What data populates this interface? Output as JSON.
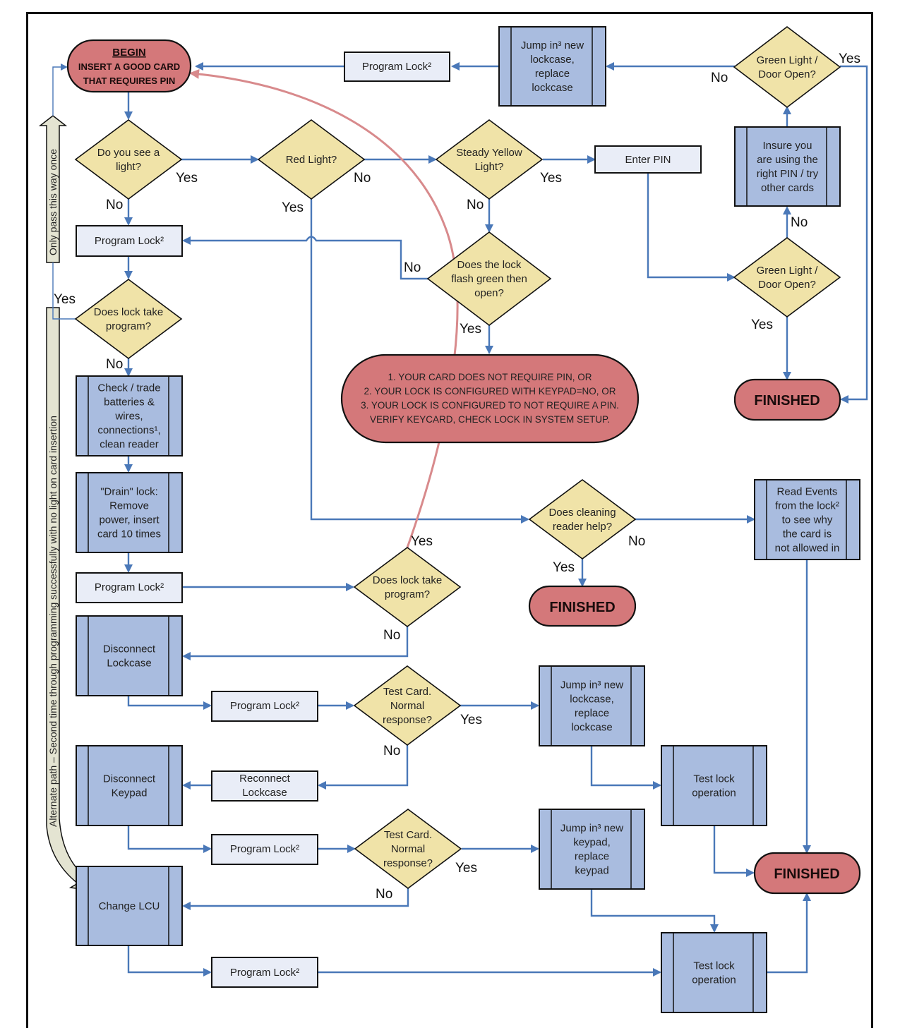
{
  "diagram": {
    "colors": {
      "connector": "#4a78b8",
      "terminal_fill": "#d4787a",
      "decision_fill": "#f0e3a8",
      "subprocess_fill": "#a9bcdf",
      "process_fill": "#e9edf7",
      "return_curve": "#d88a8c"
    },
    "begin": {
      "title": "BEGIN",
      "line1": "Insert a good card",
      "line2": "that requires PIN"
    },
    "nodes": {
      "program_lock_top": "Program Lock²",
      "jump_lockcase_top": [
        "Jump in³ new",
        "lockcase,",
        "replace",
        "lockcase"
      ],
      "green_light_top": [
        "Green Light /",
        "Door Open?"
      ],
      "see_light": [
        "Do you see a",
        "light?"
      ],
      "red_light": [
        "Red Light?"
      ],
      "steady_yellow": [
        "Steady Yellow",
        "Light?"
      ],
      "enter_pin": "Enter PIN",
      "insure_pin": [
        "Insure you",
        "are using the",
        "right PIN / try",
        "other cards"
      ],
      "program_lock_2": "Program Lock²",
      "flash_green": [
        "Does the lock",
        "flash green then",
        "open?"
      ],
      "green_light_mid": [
        "Green Light /",
        "Door Open?"
      ],
      "lock_take_program_1": [
        "Does lock take",
        "program?"
      ],
      "note_lines": [
        "1. Your card does not require PIN, or",
        "2. Your lock is configured with Keypad=No, or",
        "3. Your lock is configured to not require a PIN.",
        "Verify keycard, check lock in System Setup."
      ],
      "finished_1": "Finished",
      "check_batteries": [
        "Check / trade",
        "batteries &",
        "wires,",
        "connections¹,",
        "clean reader"
      ],
      "drain_lock": [
        "\"Drain\" lock:",
        "Remove",
        "power, insert",
        "card 10 times"
      ],
      "cleaning_help": [
        "Does cleaning",
        "reader help?"
      ],
      "read_events": [
        "Read Events",
        "from the lock²",
        "to see why",
        "the card is",
        "not allowed in"
      ],
      "program_lock_3": "Program Lock²",
      "lock_take_program_2": [
        "Does lock take",
        "program?"
      ],
      "finished_2": "Finished",
      "disconnect_lockcase": [
        "Disconnect",
        "Lockcase"
      ],
      "program_lock_4": "Program Lock²",
      "test_card_1": [
        "Test Card.",
        "Normal",
        "response?"
      ],
      "jump_lockcase_bottom": [
        "Jump in³ new",
        "lockcase,",
        "replace",
        "lockcase"
      ],
      "disconnect_keypad": [
        "Disconnect",
        "Keypad"
      ],
      "reconnect_lockcase": [
        "Reconnect",
        "Lockcase"
      ],
      "test_lock_op_1": [
        "Test lock",
        "operation"
      ],
      "program_lock_5": "Program Lock²",
      "test_card_2": [
        "Test Card.",
        "Normal",
        "response?"
      ],
      "jump_keypad": [
        "Jump in³ new",
        "keypad,",
        "replace",
        "keypad"
      ],
      "finished_3": "Finished",
      "change_lcu": [
        "Change LCU"
      ],
      "program_lock_6": "Program Lock²",
      "test_lock_op_2": [
        "Test lock",
        "operation"
      ]
    },
    "labels": {
      "yes": "Yes",
      "no": "No"
    },
    "side_notes": {
      "only_once": "Only pass this way once",
      "alternate_path": "Alternate path – Second time through programming successfully with no light on card insertion"
    }
  }
}
